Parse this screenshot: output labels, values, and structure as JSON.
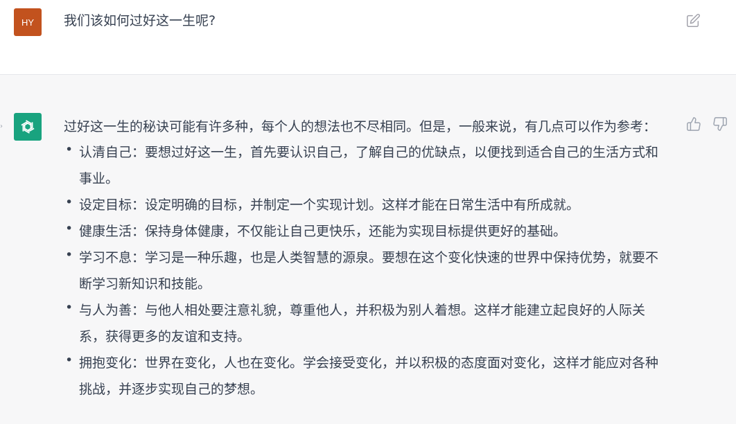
{
  "user_message": {
    "avatar_initials": "HY",
    "text": "我们该如何过好这一生呢?"
  },
  "assistant_message": {
    "intro": "过好这一生的秘诀可能有许多种，每个人的想法也不尽相同。但是，一般来说，有几点可以作为参考：",
    "items": [
      {
        "text": "认清自己：要想过好这一生，首先要认识自己，了解自己的优缺点，以便找到适合自己的生活方式和事业。"
      },
      {
        "text": "设定目标：设定明确的目标，并制定一个实现计划。这样才能在日常生活中有所成就。"
      },
      {
        "text": "健康生活：保持身体健康，不仅能让自己更快乐，还能为实现目标提供更好的基础。"
      },
      {
        "text": "学习不息：学习是一种乐趣，也是人类智慧的源泉。要想在这个变化快速的世界中保持优势，就要不断学习新知识和技能。"
      },
      {
        "text": "与人为善：与他人相处要注意礼貌，尊重他人，并积极为别人着想。这样才能建立起良好的人际关系，获得更多的友谊和支持。"
      },
      {
        "text": "拥抱变化：世界在变化，人也在变化。学会接受变化，并以积极的态度面对变化，这样才能应对各种挑战，并逐步实现自己的梦想。"
      }
    ]
  },
  "icons": {
    "edit": "edit-icon",
    "assistant_logo": "openai-logo-icon",
    "thumb_up": "thumbs-up-icon",
    "thumb_down": "thumbs-down-icon"
  },
  "colors": {
    "user_avatar_bg": "#c2521e",
    "assistant_avatar_bg": "#19a37f",
    "assistant_row_bg": "#f7f7f8",
    "text": "#374151"
  }
}
